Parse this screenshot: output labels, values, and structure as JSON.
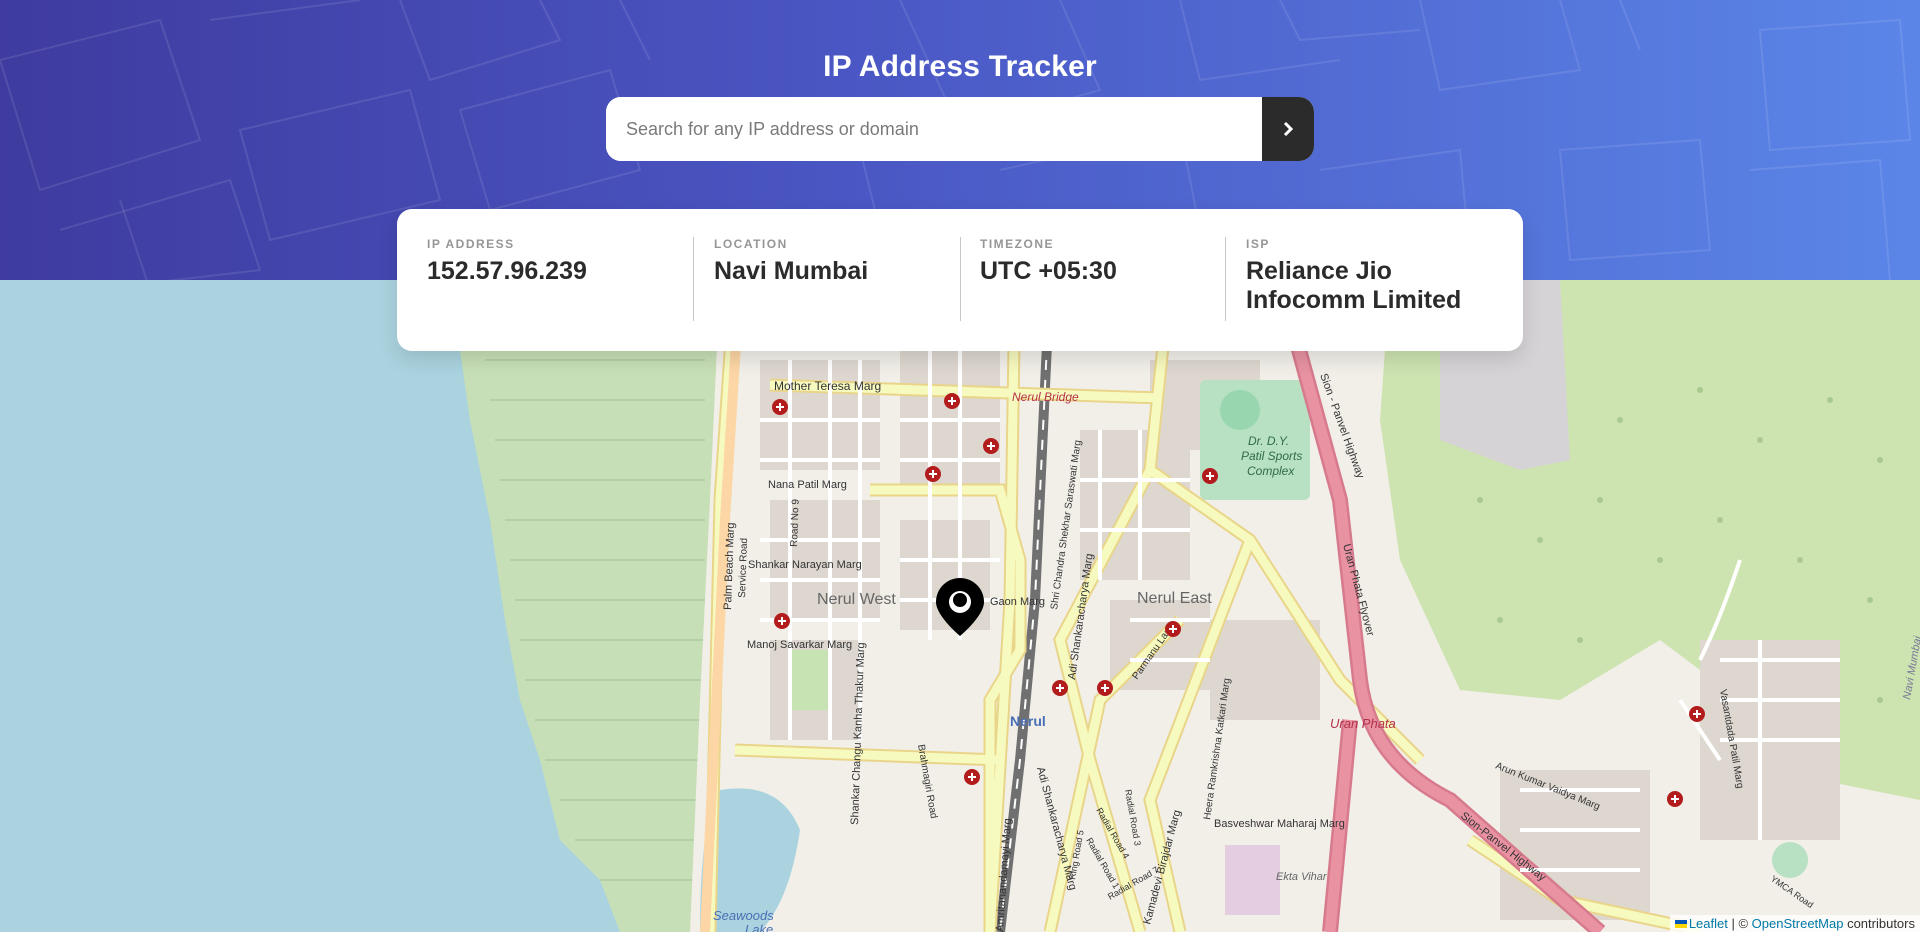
{
  "header": {
    "title": "IP Address Tracker",
    "search": {
      "placeholder": "Search for any IP address or domain",
      "value": ""
    },
    "submit_icon": "chevron-right-icon"
  },
  "info": {
    "ip": {
      "label": "IP ADDRESS",
      "value": "152.57.96.239"
    },
    "location": {
      "label": "LOCATION",
      "value": "Navi Mumbai"
    },
    "timezone": {
      "label": "TIMEZONE",
      "value": "UTC +05:30"
    },
    "isp": {
      "label": "ISP",
      "value": "Reliance Jio Infocomm Limited"
    }
  },
  "map": {
    "labels": {
      "nerul_west": "Nerul West",
      "nerul_east": "Nerul East",
      "nerul": "Nerul",
      "uran_phata": "Uran Phata",
      "nerul_bridge": "Nerul Bridge",
      "mother_teresa": "Mother Teresa Marg",
      "palm_beach": "Palm Beach Marg",
      "dy_patil_1": "Dr. D.Y.",
      "dy_patil_2": "Patil Sports",
      "dy_patil_3": "Complex",
      "sion_panvel": "Sion - Panvel Highway",
      "sion_panvel_2": "Sion-Panvel Highway",
      "uran_phata_flyover": "Uran Phata Flyover",
      "seawoods": "Seawoods",
      "lake": "Lake",
      "ekta_vihar": "Ekta Vihar",
      "navi_mumbai": "Navi Mumbai",
      "nana_patil": "Nana Patil Marg",
      "shankar_narayan": "Shankar Narayan Marg",
      "manoj_savarkar": "Manoj Savarkar Marg",
      "shankar_changu": "Shankar Changu Kanha Thakur Marg",
      "brahmagiri": "Brahmagiri Road",
      "amritanandamayi": "Amritanandamayi Marg",
      "adi_shankaracharya": "Adi Shankaracharya Marg",
      "adi_shankaracharya_2": "Adi Shankaracharya Marg",
      "shri_chandra": "Shri Chandra Shekhar Saraswati Marg",
      "basveshwar": "Basveshwar Maharaj Marg",
      "kamadevi": "Kamadevi Birajdar Marg",
      "heera": "Heera Ramkrishna Katkari Marg",
      "arun_kumar": "Arun Kumar Vaidya Marg",
      "vasantdada": "Vasantdada Patil Marg",
      "parmanu": "Parmanu Lane",
      "service_road": "Service Road",
      "road_no9": "Road No 9",
      "radial_road_1": "Radial Road 1",
      "radial_road_3": "Radial Road 3",
      "radial_road_4": "Radial Road 4",
      "radial_road_7": "Radial Road 7",
      "ring_road_5": "Ring Road 5",
      "ymca": "YMCA Road",
      "gaon": "Gaon Marg"
    },
    "marker_icon": "location-pin-icon",
    "hospital_icon": "hospital-icon"
  },
  "attribution": {
    "leaflet": "Leaflet",
    "separator": " | © ",
    "osm": "OpenStreetMap",
    "suffix": " contributors"
  },
  "colors": {
    "header_start": "#3f3b9f",
    "header_end": "#5b86e8",
    "water": "#aad3df",
    "land": "#f2efe9",
    "park": "#cdebb0",
    "major_road": "#f7fabf",
    "highway": "#e892a2",
    "text_dark": "#2b2b2b",
    "text_muted": "#969696"
  }
}
